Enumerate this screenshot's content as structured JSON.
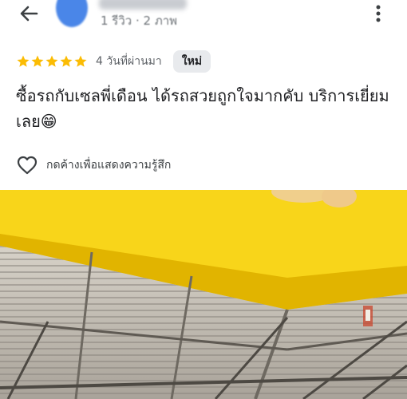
{
  "header": {
    "reviewer_meta": "1 รีวิว · 2 ภาพ",
    "back_icon": "arrow-back-icon",
    "more_icon": "more-vert-icon"
  },
  "review": {
    "rating": 5,
    "rating_max": 5,
    "date": "4 วันที่ผ่านมา",
    "badge": "ใหม่",
    "text": "ซื้อรถกับเซลพี่เดือน ได้รถสวยถูกใจมากคับ บริการเยี่ยมเลย😁"
  },
  "actions": {
    "like_label": "กดค้างเพื่อแสดงความรู้สึก",
    "like_icon": "heart-outline-icon"
  },
  "colors": {
    "star": "#fbbc04",
    "photo_sign": "#f6d21c"
  }
}
